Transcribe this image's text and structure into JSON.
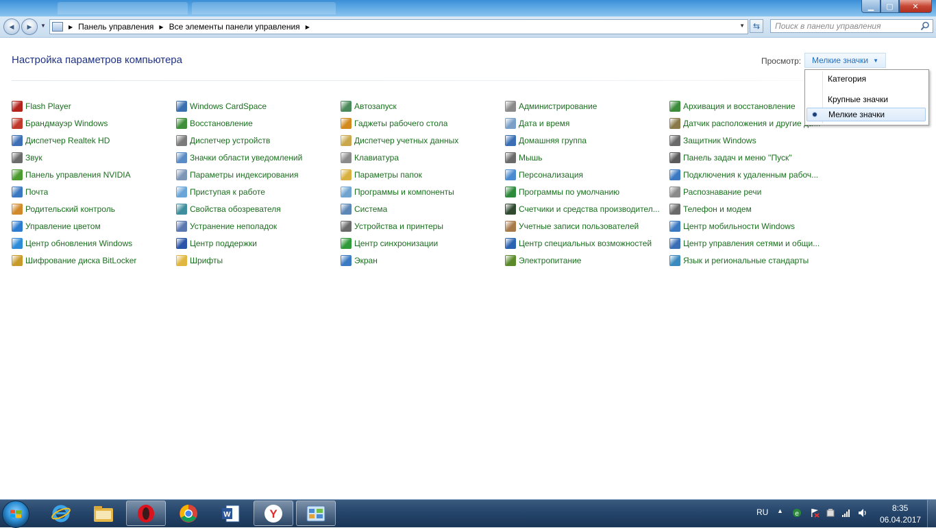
{
  "window": {
    "minimize_glyph": "▁",
    "maximize_glyph": "▢",
    "close_glyph": "✕"
  },
  "address_bar": {
    "back_glyph": "◀",
    "forward_glyph": "▶",
    "breadcrumbs": [
      "Панель управления",
      "Все элементы панели управления"
    ],
    "search_placeholder": "Поиск в панели управления"
  },
  "header": {
    "title": "Настройка параметров компьютера",
    "view_label": "Просмотр:",
    "view_value": "Мелкие значки"
  },
  "view_menu": {
    "options": [
      "Категория",
      "Крупные значки",
      "Мелкие значки"
    ],
    "selected": "Мелкие значки"
  },
  "items": [
    [
      "Flash Player",
      "Брандмауэр Windows",
      "Диспетчер Realtek HD",
      "Звук",
      "Панель управления NVIDIA",
      "Почта",
      "Родительский контроль",
      "Управление цветом",
      "Центр обновления Windows",
      "Шифрование диска BitLocker"
    ],
    [
      "Windows CardSpace",
      "Восстановление",
      "Диспетчер устройств",
      "Значки области уведомлений",
      "Параметры индексирования",
      "Приступая к работе",
      "Свойства обозревателя",
      "Устранение неполадок",
      "Центр поддержки",
      "Шрифты"
    ],
    [
      "Автозапуск",
      "Гаджеты рабочего стола",
      "Диспетчер учетных данных",
      "Клавиатура",
      "Параметры папок",
      "Программы и компоненты",
      "Система",
      "Устройства и принтеры",
      "Центр синхронизации",
      "Экран"
    ],
    [
      "Администрирование",
      "Дата и время",
      "Домашняя группа",
      "Мышь",
      "Персонализация",
      "Программы по умолчанию",
      "Счетчики и средства производител...",
      "Учетные записи пользователей",
      "Центр специальных возможностей",
      "Электропитание"
    ],
    [
      "Архивация и восстановление",
      "Датчик расположения и другие дат...",
      "Защитник Windows",
      "Панель задач и меню ''Пуск''",
      "Подключения к удаленным рабоч...",
      "Распознавание речи",
      "Телефон и модем",
      "Центр мобильности Windows",
      "Центр управления сетями и общи...",
      "Язык и региональные стандарты"
    ]
  ],
  "icon_colors": [
    [
      "#b3221b",
      "#c0392b",
      "#3d6fb6",
      "#6b6b6b",
      "#4c9b2f",
      "#3a78c2",
      "#d1892a",
      "#2b7bd0",
      "#2d8bd8",
      "#c79a2a"
    ],
    [
      "#3a6fb0",
      "#3f8e3a",
      "#7a7a7a",
      "#5a8bc4",
      "#7d96b8",
      "#6aa5d8",
      "#3f8e9e",
      "#5a77b0",
      "#2a55a8",
      "#e0b540"
    ],
    [
      "#4a8a5a",
      "#d28a1f",
      "#c9a74a",
      "#8a8a8a",
      "#d8b040",
      "#6fa4d0",
      "#5b86b5",
      "#6a6a6a",
      "#2f9a3a",
      "#3a7ac2"
    ],
    [
      "#8a8a8a",
      "#7aa0c8",
      "#3a6fb6",
      "#6a6a6a",
      "#4a8ad0",
      "#2d8a3a",
      "#2f4a2f",
      "#a87a4a",
      "#2a64b0",
      "#5a8a2a"
    ],
    [
      "#3c8c3c",
      "#8a7a4a",
      "#6a6a6a",
      "#5a5a5a",
      "#3a78c2",
      "#8a8a8a",
      "#6a6a6a",
      "#3a78c2",
      "#3a6fb6",
      "#3a8ac0"
    ]
  ],
  "taskbar": {
    "language": "RU",
    "time": "8:35",
    "date": "06.04.2017",
    "apps": [
      "internet-explorer",
      "file-explorer",
      "opera",
      "chrome",
      "word",
      "yandex-browser",
      "control-panel"
    ],
    "active_app": "control-panel"
  },
  "colors": {
    "link_green": "#1b6e1f",
    "heading_blue": "#1e3287",
    "accent_blue": "#1f6fc4"
  }
}
